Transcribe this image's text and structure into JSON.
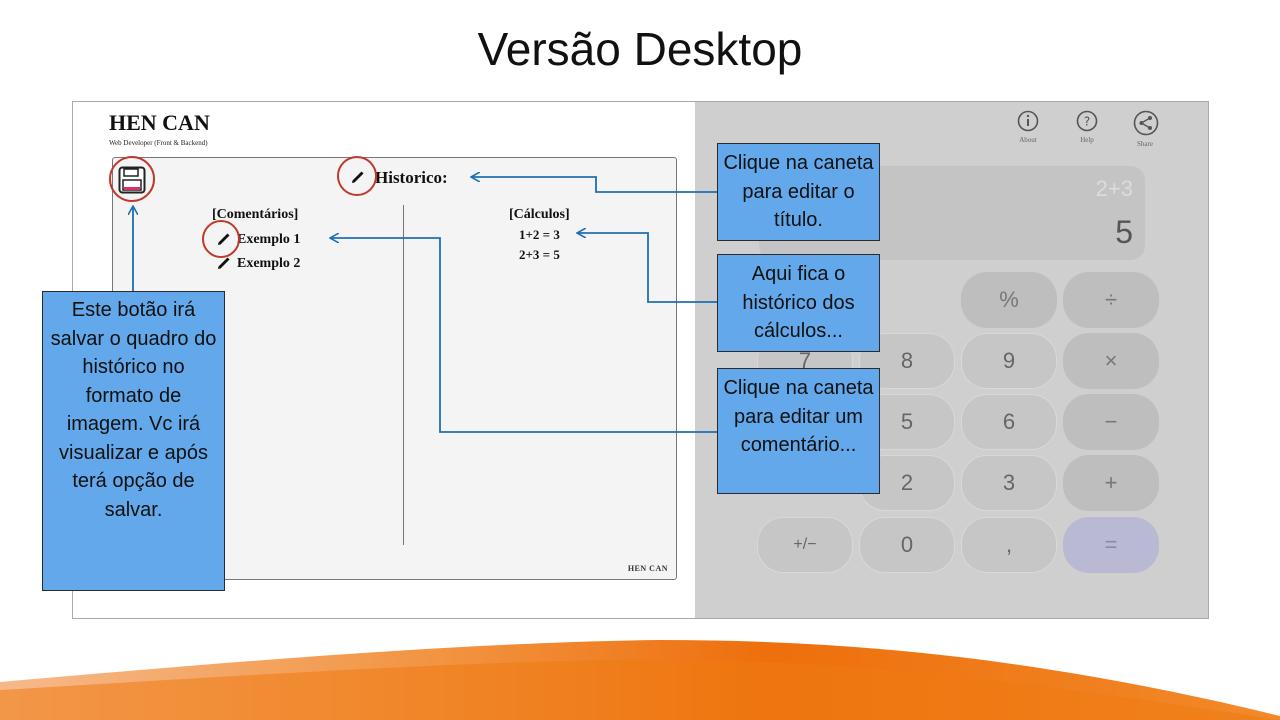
{
  "slide": {
    "title": "Versão Desktop"
  },
  "app": {
    "brand": "HEN CAN",
    "brand_subtitle": "Web Developer (Front & Backend)",
    "history_title": "Historico:",
    "comments_header": "[Comentários]",
    "calcs_header": "[Cálculos]",
    "comments": [
      "Exemplo 1",
      "Exemplo 2"
    ],
    "calculations": [
      "1+2 = 3",
      "2+3 = 5"
    ],
    "footer_brand": "HEN CAN"
  },
  "calculator": {
    "top_icons": [
      {
        "name": "info-icon",
        "label": "About"
      },
      {
        "name": "help-icon",
        "label": "Help"
      },
      {
        "name": "share-icon",
        "label": "Share"
      }
    ],
    "display": {
      "expression": "2+3",
      "result": "5"
    },
    "keys": {
      "backspace": "⌫",
      "percent": "%",
      "divide": "÷",
      "seven": "7",
      "eight": "8",
      "nine": "9",
      "multiply": "×",
      "five": "5",
      "six": "6",
      "minus": "−",
      "two": "2",
      "three": "3",
      "plus": "+",
      "plusminus": "+/−",
      "zero": "0",
      "comma": ",",
      "equals": "="
    }
  },
  "callouts": {
    "edit_title": "Clique na caneta para editar o título.",
    "history_info": "Aqui fica o histórico dos cálculos...",
    "edit_comment": "Clique na caneta para editar um comentário...",
    "save_button": "Este botão irá salvar o quadro do histórico no formato de imagem. Vc irá visualizar e após terá opção de salvar."
  },
  "colors": {
    "callout_fill": "#62a8ea",
    "arrow": "#1f6fb2",
    "highlight_ring": "#c0392b",
    "calc_background": "#cfcfcf",
    "wave_orange": "#f07a10"
  }
}
